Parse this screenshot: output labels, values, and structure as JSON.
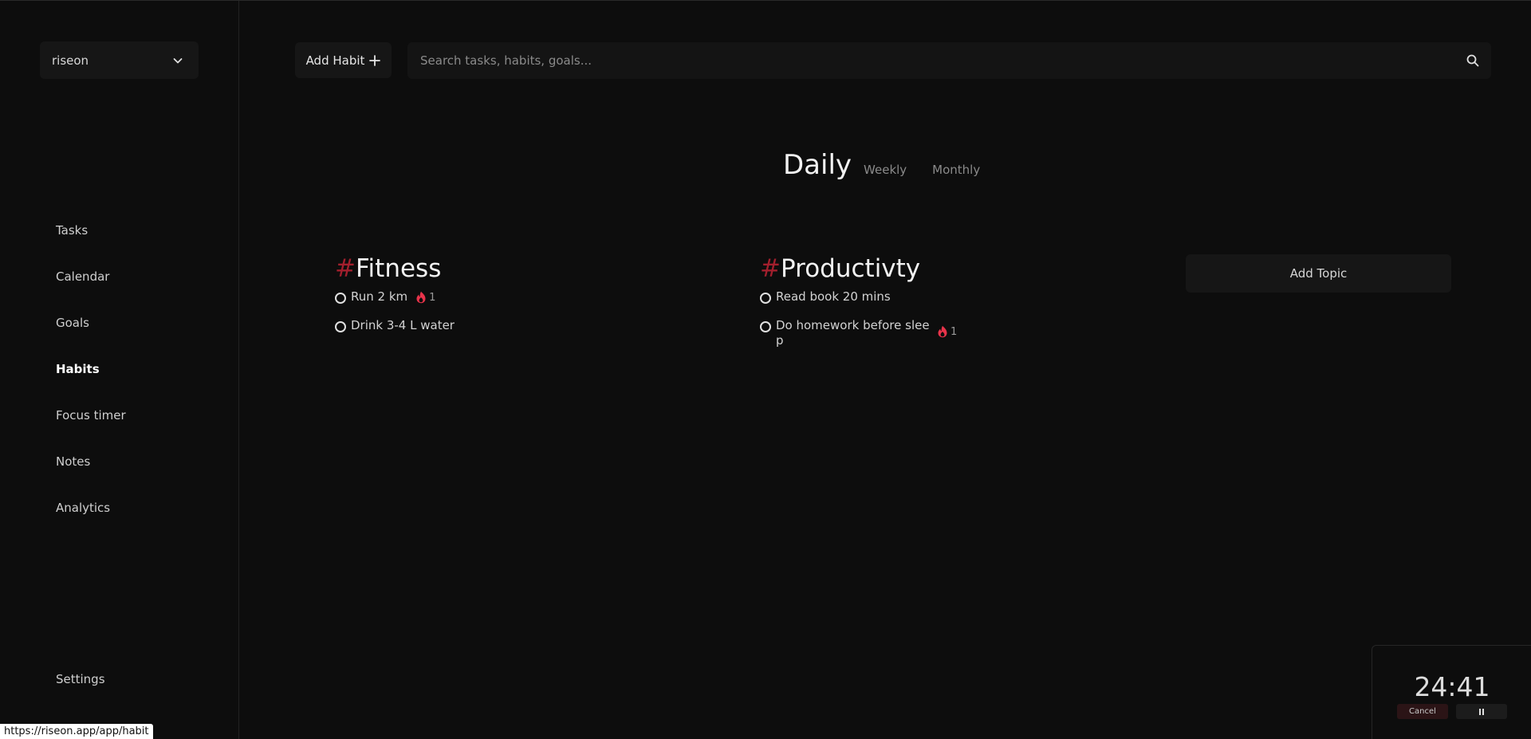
{
  "sidebar": {
    "workspace_name": "riseon",
    "items": [
      {
        "label": "Tasks"
      },
      {
        "label": "Calendar"
      },
      {
        "label": "Goals"
      },
      {
        "label": "Habits"
      },
      {
        "label": "Focus timer"
      },
      {
        "label": "Notes"
      },
      {
        "label": "Analytics"
      }
    ],
    "settings_label": "Settings",
    "active_item": "Habits"
  },
  "toolbar": {
    "add_habit_label": "Add Habit",
    "search_placeholder": "Search tasks, habits, goals..."
  },
  "tabs": {
    "daily": "Daily",
    "weekly": "Weekly",
    "monthly": "Monthly",
    "active": "Daily"
  },
  "topics": [
    {
      "hash": "#",
      "name": "Fitness",
      "habits": [
        {
          "name": "Run 2 km",
          "streak": "1"
        },
        {
          "name": "Drink 3-4 L water"
        }
      ]
    },
    {
      "hash": "#",
      "name": "Productivty",
      "habits": [
        {
          "name": "Read book 20 mins"
        },
        {
          "name_line1": "Do homework before slee",
          "name_line2": "p",
          "streak": "1"
        }
      ]
    }
  ],
  "add_topic_label": "Add Topic",
  "timer": {
    "time": "24:41",
    "cancel_label": "Cancel"
  },
  "status_url": "https://riseon.app/app/habit",
  "colors": {
    "background": "#0d0d0d",
    "panel": "#161616",
    "accent_hash": "#a21f2d",
    "streak_flame": "#e8334a"
  }
}
